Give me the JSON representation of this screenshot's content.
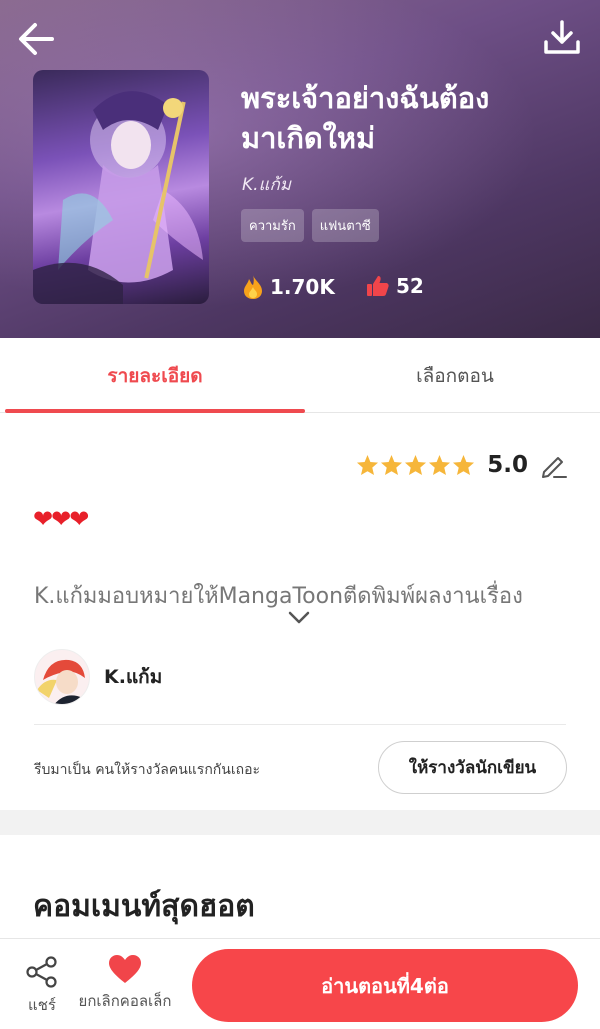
{
  "header": {
    "title_line1": "พระเจ้าอย่างฉันต้อง",
    "title_line2": "มาเกิดใหม่",
    "author": "K.แก้ม",
    "tags": [
      "ความรัก",
      "แฟนตาซี"
    ],
    "views": "1.70K",
    "likes": "52"
  },
  "tabs": {
    "detail_label": "รายละเอียด",
    "episodes_label": "เลือกตอน"
  },
  "detail": {
    "rating_value": "5.0",
    "rating_stars": 5,
    "hearts": "❤❤❤",
    "description": "K.แก้มมอบหมายให้MangaToonตีดพิมพ์ผลงานเรื่อง",
    "author_name": "K.แก้ม",
    "reward_text": "รีบมาเป็น คนให้รางวัลคนแรกกันเถอะ",
    "reward_button": "ให้รางวัลนักเขียน"
  },
  "comments": {
    "title": "คอมเมนท์สุดฮอต"
  },
  "bottom_bar": {
    "share_label": "แชร์",
    "collect_label": "ยกเลิกคอลเล็ก",
    "read_button": "อ่านตอนที่4ต่อ"
  },
  "colors": {
    "accent": "#ef4a4f",
    "star": "#f6b63a"
  }
}
